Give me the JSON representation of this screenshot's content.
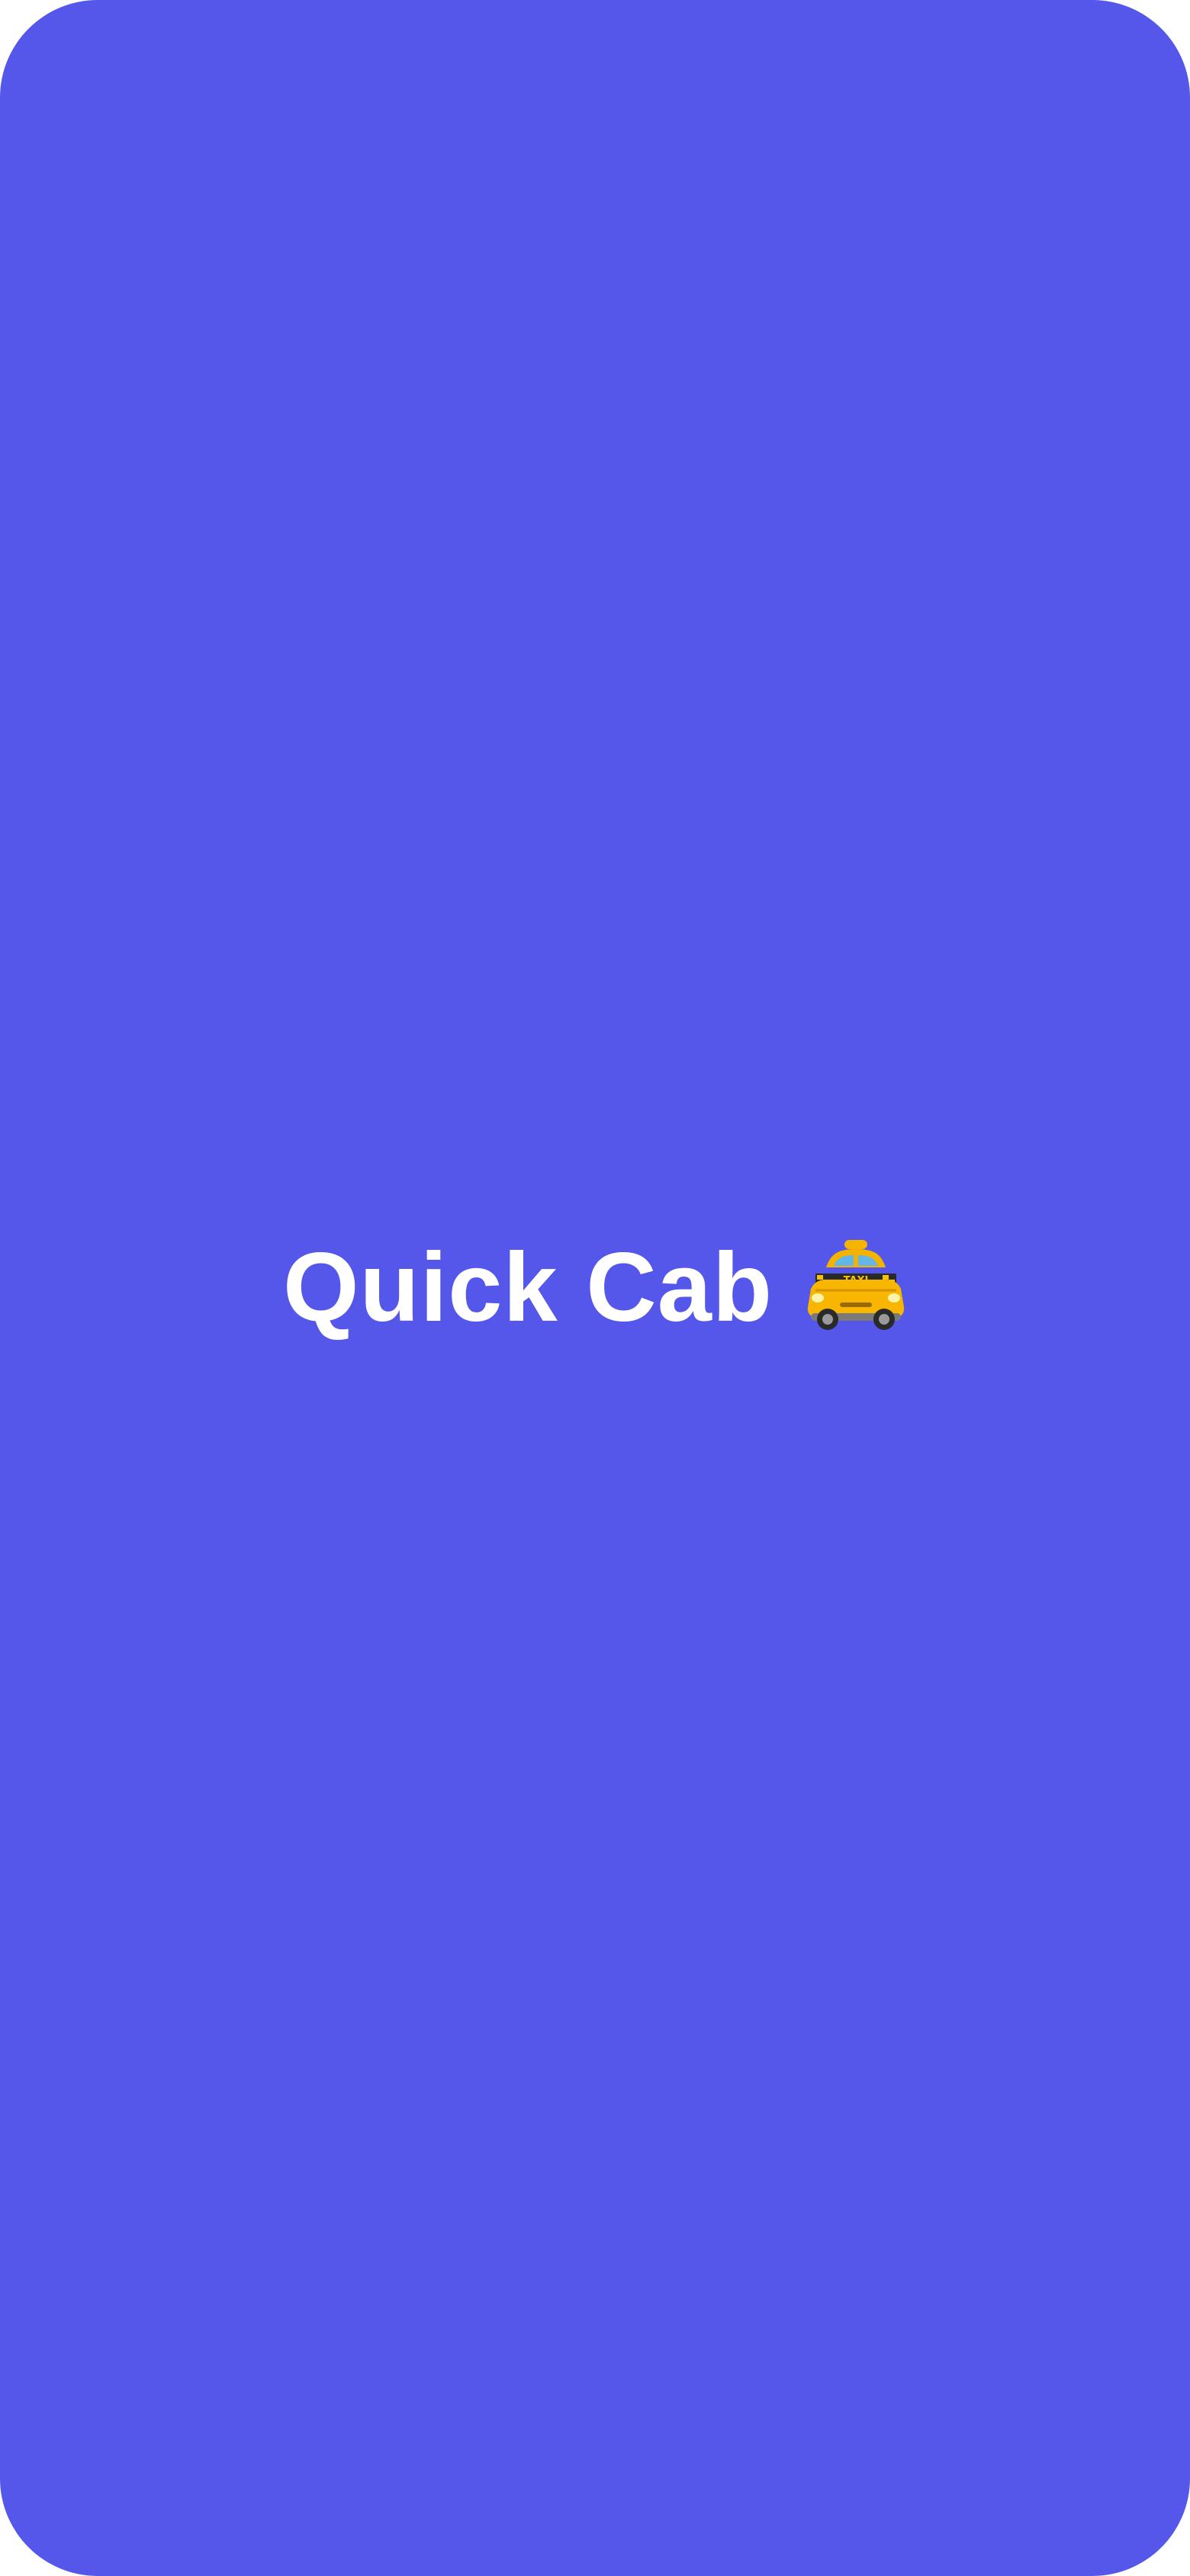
{
  "app": {
    "title": "Quick Cab",
    "icon": "taxi-icon",
    "background_color": "#5457E9",
    "text_color": "#FFFFFF"
  },
  "taxi_sign": "TAXI"
}
